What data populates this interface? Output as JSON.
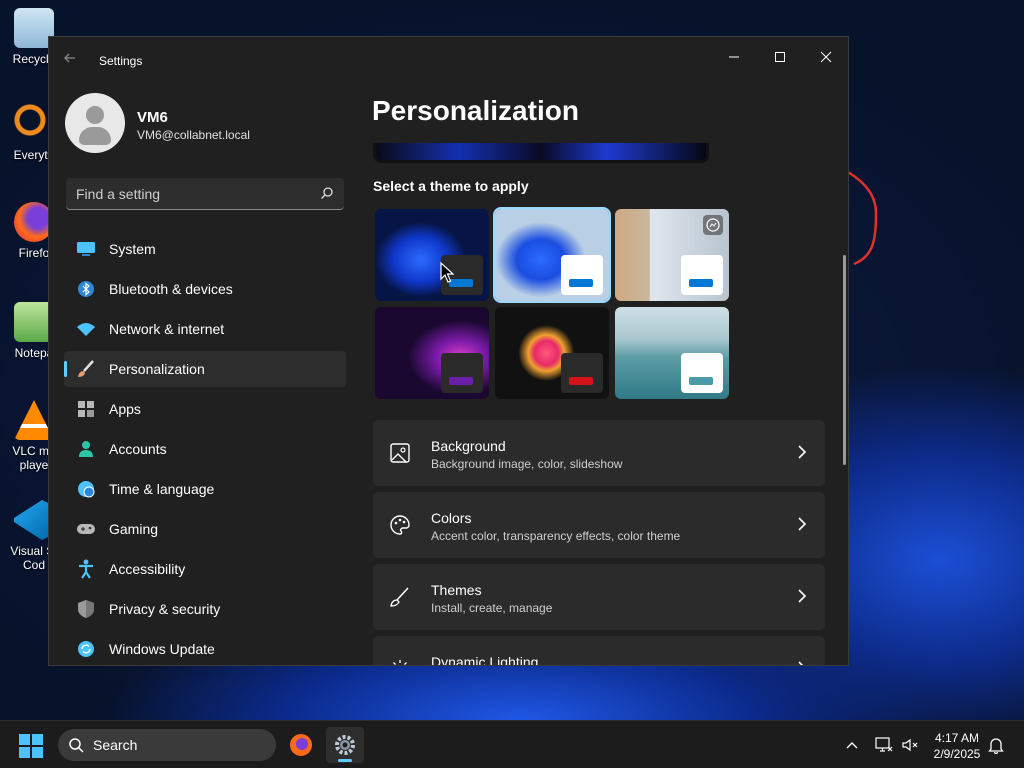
{
  "desktop": {
    "icons": [
      {
        "label": "Recycle",
        "icon": "recycle-bin-icon"
      },
      {
        "label": "Everyth",
        "icon": "everything-search-icon"
      },
      {
        "label": "Firefo",
        "icon": "firefox-icon"
      },
      {
        "label": "Notepa",
        "icon": "notepad-icon"
      },
      {
        "label": "VLC me playe",
        "icon": "vlc-icon"
      },
      {
        "label": "Visual St Cod",
        "icon": "vscode-icon"
      }
    ]
  },
  "window": {
    "title": "Settings",
    "controls": {
      "minimize": "minimize-icon",
      "maximize": "maximize-icon",
      "close": "close-icon"
    }
  },
  "user": {
    "name": "VM6",
    "email": "VM6@collabnet.local"
  },
  "search": {
    "placeholder": "Find a setting"
  },
  "sidebar": {
    "items": [
      {
        "label": "System",
        "icon": "system-icon",
        "color": "#4cc2ff"
      },
      {
        "label": "Bluetooth & devices",
        "icon": "bluetooth-icon",
        "color": "#2b88d8"
      },
      {
        "label": "Network & internet",
        "icon": "wifi-icon",
        "color": "#4cc2ff"
      },
      {
        "label": "Personalization",
        "icon": "paintbrush-icon",
        "color": "#e6a06c",
        "active": true
      },
      {
        "label": "Apps",
        "icon": "apps-icon",
        "color": "#b8b8b8"
      },
      {
        "label": "Accounts",
        "icon": "accounts-icon",
        "color": "#2ec4a8"
      },
      {
        "label": "Time & language",
        "icon": "globe-clock-icon",
        "color": "#4cc2ff"
      },
      {
        "label": "Gaming",
        "icon": "gamepad-icon",
        "color": "#b8b8b8"
      },
      {
        "label": "Accessibility",
        "icon": "accessibility-icon",
        "color": "#4cc2ff"
      },
      {
        "label": "Privacy & security",
        "icon": "shield-icon",
        "color": "#9a9a9a"
      },
      {
        "label": "Windows Update",
        "icon": "update-icon",
        "color": "#4cc2ff"
      }
    ]
  },
  "main": {
    "title": "Personalization",
    "theme_heading": "Select a theme to apply",
    "themes": [
      {
        "name": "windows-dark",
        "chip_bg": "#2a2a2a",
        "bar": "#0078d4"
      },
      {
        "name": "windows-light",
        "chip_bg": "#ffffff",
        "bar": "#0078d4",
        "selected": true
      },
      {
        "name": "captured-motion",
        "chip_bg": "#ffffff",
        "bar": "#0078d4"
      },
      {
        "name": "glow",
        "chip_bg": "#2a2a2a",
        "bar": "#6b1fa8"
      },
      {
        "name": "flow",
        "chip_bg": "#2a2a2a",
        "bar": "#d4121a"
      },
      {
        "name": "sunrise",
        "chip_bg": "#ffffff",
        "bar": "#4a9aa8"
      }
    ],
    "cards": [
      {
        "title": "Background",
        "subtitle": "Background image, color, slideshow",
        "icon": "image-icon"
      },
      {
        "title": "Colors",
        "subtitle": "Accent color, transparency effects, color theme",
        "icon": "palette-icon"
      },
      {
        "title": "Themes",
        "subtitle": "Install, create, manage",
        "icon": "brush-icon"
      },
      {
        "title": "Dynamic Lighting",
        "subtitle": "",
        "icon": "lighting-icon"
      }
    ]
  },
  "taskbar": {
    "search_label": "Search",
    "time": "4:17 AM",
    "date": "2/9/2025",
    "accent": "#60cdff"
  }
}
